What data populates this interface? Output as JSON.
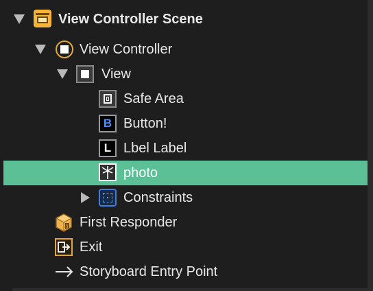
{
  "outline": {
    "items": [
      {
        "label": "View Controller Scene",
        "icon": "scene-icon",
        "disclosure": "open"
      },
      {
        "label": "View Controller",
        "icon": "view-controller-icon",
        "disclosure": "open"
      },
      {
        "label": "View",
        "icon": "view-icon",
        "disclosure": "open"
      },
      {
        "label": "Safe Area",
        "icon": "safe-area-icon"
      },
      {
        "label": "Button!",
        "icon": "button-icon",
        "icon_letter": "B"
      },
      {
        "label": "Lbel Label",
        "icon": "label-icon",
        "icon_letter": "L"
      },
      {
        "label": "photo",
        "icon": "image-view-icon",
        "selected": true
      },
      {
        "label": "Constraints",
        "icon": "constraints-icon",
        "disclosure": "closed"
      },
      {
        "label": "First Responder",
        "icon": "first-responder-icon"
      },
      {
        "label": "Exit",
        "icon": "exit-icon"
      },
      {
        "label": "Storyboard Entry Point",
        "icon": "arrow-right-icon"
      }
    ]
  },
  "colors": {
    "background": "#1e1e1e",
    "selection": "#5cc096",
    "text": "#e8e8e8",
    "scene_accent": "#f6b43b",
    "button_letter": "#4f8ff7",
    "constraints_accent": "#3f7de0"
  }
}
